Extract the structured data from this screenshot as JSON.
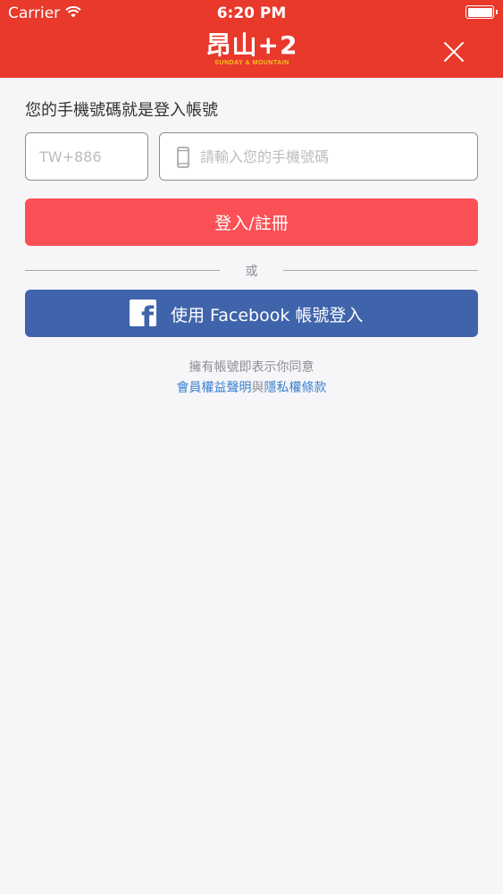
{
  "status_bar": {
    "carrier": "Carrier",
    "time": "6:20 PM"
  },
  "header": {
    "logo_main": "昂山+2",
    "logo_sub": "SUNDAY & MOUNTAIN",
    "close_icon": "close-icon"
  },
  "form": {
    "prompt": "您的手機號碼就是登入帳號",
    "country_placeholder": "TW+886",
    "phone_placeholder": "請輸入您的手機號碼",
    "phone_icon": "phone-icon",
    "login_button": "登入/註冊",
    "or_label": "或",
    "facebook_button": "使用 Facebook 帳號登入",
    "facebook_icon": "facebook-icon"
  },
  "terms": {
    "agree_text": "擁有帳號即表示你同意",
    "member_rights_link": "會員權益聲明",
    "conjunction": "與",
    "privacy_link": "隱私權條款"
  },
  "colors": {
    "header": "#e8392b",
    "login_button": "#fb5055",
    "facebook_button": "#3f64ab",
    "link": "#3b80cf",
    "background": "#f6f6f8"
  }
}
